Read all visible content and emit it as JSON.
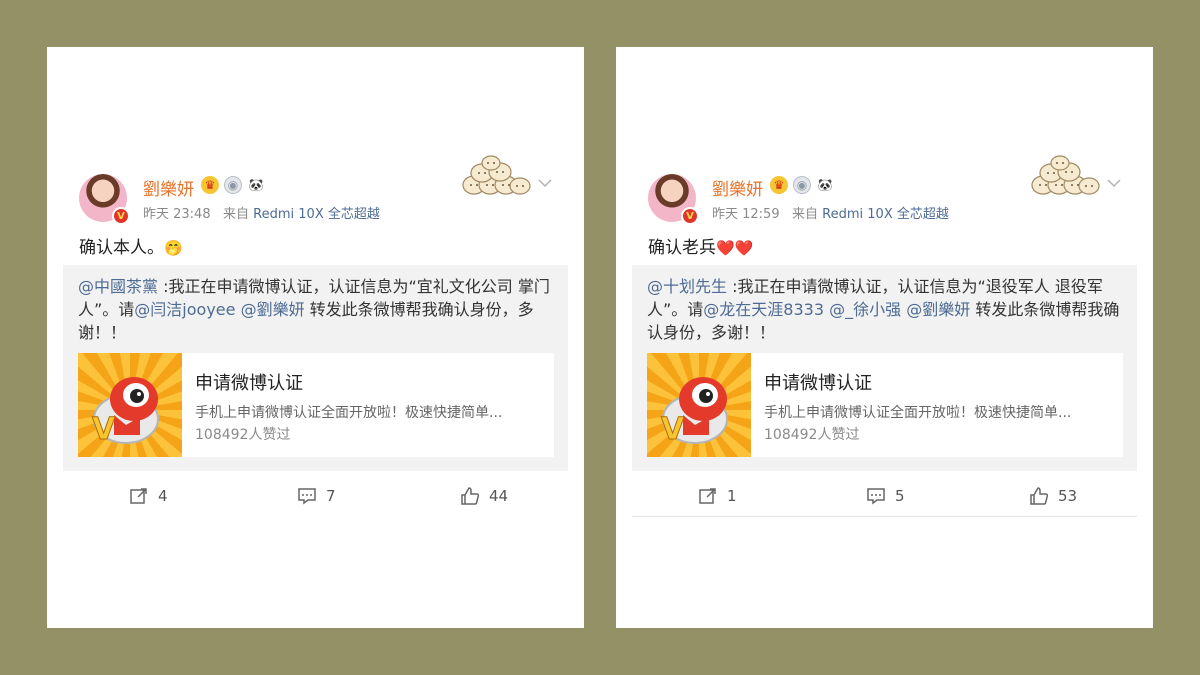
{
  "posts": [
    {
      "username": "劉樂妍",
      "avatar_badge": "V",
      "badges": [
        "crown-badge-icon",
        "medal-badge-icon",
        "panda-icon"
      ],
      "time": "昨天 23:48",
      "source_prefix": "来自",
      "device": "Redmi 10X 全芯超越",
      "text": "确认本人。",
      "text_emoji": "🤭",
      "quote": {
        "mention_1": "@中國茶黨",
        "body_1": " :我正在申请微博认证，认证信息为“宜礼文化公司 掌门人”。请",
        "mention_2": "@闫洁jooyee",
        "sep_1": " ",
        "mention_3": "@劉樂妍",
        "body_2": " 转发此条微博帮我确认身份，多谢！！"
      },
      "link": {
        "title": "申请微博认证",
        "desc": "手机上申请微博认证全面开放啦！极速快捷简单...",
        "count": "108492人赞过"
      },
      "actions": {
        "share": "4",
        "comment": "7",
        "like": "44"
      }
    },
    {
      "username": "劉樂妍",
      "avatar_badge": "V",
      "badges": [
        "crown-badge-icon",
        "medal-badge-icon",
        "panda-icon"
      ],
      "time": "昨天 12:59",
      "source_prefix": "来自",
      "device": "Redmi 10X 全芯超越",
      "text": "确认老兵",
      "text_emoji": "❤️❤️",
      "quote": {
        "mention_1": "@十划先生",
        "body_1": " :我正在申请微博认证，认证信息为“退役军人 退役军人”。请",
        "mention_2": "@龙在天涯8333",
        "sep_1": " ",
        "mention_3": "@_徐小强",
        "sep_2": " ",
        "mention_4": "@劉樂妍",
        "body_2": " 转发此条微博帮我确认身份，多谢！！"
      },
      "link": {
        "title": "申请微博认证",
        "desc": "手机上申请微博认证全面开放啦！极速快捷简单...",
        "count": "108492人赞过"
      },
      "actions": {
        "share": "1",
        "comment": "5",
        "like": "53"
      }
    }
  ],
  "colors": {
    "background": "#939165",
    "username": "#e8742a",
    "link_blue": "#4d6b94",
    "quote_bg": "#f2f2f2"
  }
}
